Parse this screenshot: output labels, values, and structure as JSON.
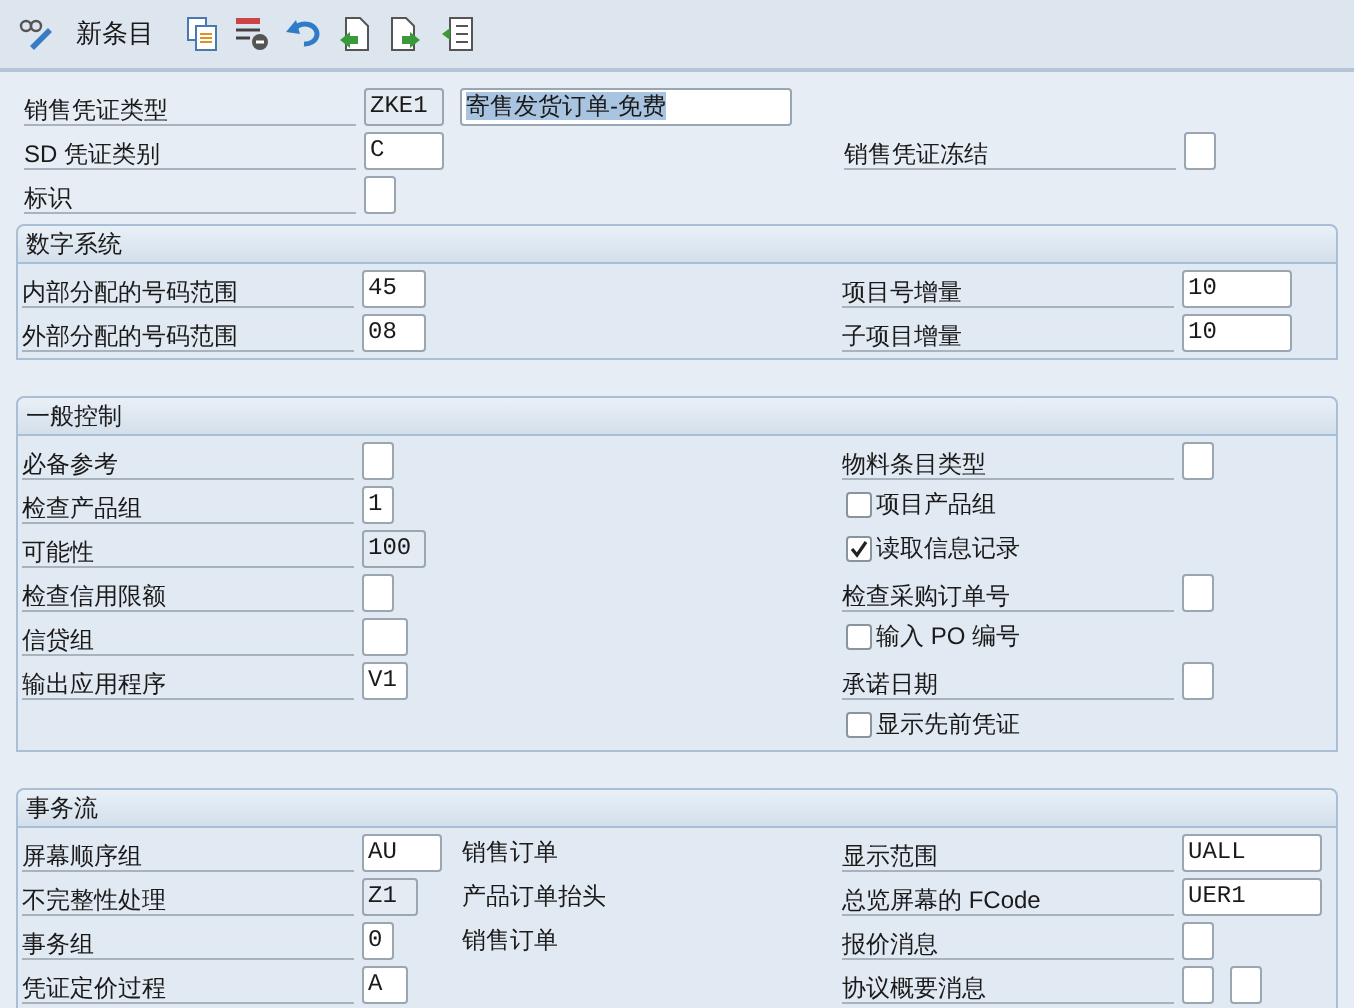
{
  "toolbar": {
    "label": "新条目"
  },
  "header": {
    "rows": [
      {
        "left": {
          "kind": "field",
          "label": "销售凭证类型",
          "value": "ZKE1",
          "readonly": true,
          "description": {
            "value": "寄售发货订单-免费",
            "highlighted": true
          }
        }
      },
      {
        "left": {
          "kind": "field",
          "label": "SD 凭证类别",
          "value": "C",
          "readonly": false
        },
        "right": {
          "kind": "field",
          "label": "销售凭证冻结",
          "readonly": false
        }
      },
      {
        "left": {
          "kind": "field",
          "label": "标识",
          "readonly": false
        }
      }
    ]
  },
  "sections": [
    {
      "title": "数字系统",
      "rows": [
        {
          "left": {
            "kind": "field",
            "label": "内部分配的号码范围",
            "value": "45",
            "readonly": false
          },
          "right": {
            "kind": "field",
            "label": "项目号增量",
            "value": "10",
            "readonly": false
          }
        },
        {
          "left": {
            "kind": "field",
            "label": "外部分配的号码范围",
            "value": "08",
            "readonly": false
          },
          "right": {
            "kind": "field",
            "label": "子项目增量",
            "value": "10",
            "readonly": false
          }
        }
      ]
    },
    {
      "title": "一般控制",
      "rows": [
        {
          "left": {
            "kind": "field",
            "label": "必备参考",
            "readonly": false
          },
          "right": {
            "kind": "field",
            "label": "物料条目类型",
            "readonly": false
          }
        },
        {
          "left": {
            "kind": "field",
            "label": "检查产品组",
            "value": "1",
            "readonly": false
          },
          "right": {
            "kind": "checkbox",
            "label": "项目产品组",
            "checked": false
          }
        },
        {
          "left": {
            "kind": "field",
            "label": "可能性",
            "value": "100",
            "readonly": true
          },
          "right": {
            "kind": "checkbox",
            "label": "读取信息记录",
            "checked": true
          }
        },
        {
          "left": {
            "kind": "field",
            "label": "检查信用限额",
            "readonly": false
          },
          "right": {
            "kind": "field",
            "label": "检查采购订单号",
            "readonly": false
          }
        },
        {
          "left": {
            "kind": "field",
            "label": "信贷组",
            "readonly": false
          },
          "right": {
            "kind": "checkbox",
            "label": "输入 PO 编号",
            "checked": false
          }
        },
        {
          "left": {
            "kind": "field",
            "label": "输出应用程序",
            "value": "V1",
            "readonly": false
          },
          "right": {
            "kind": "field",
            "label": "承诺日期",
            "readonly": false
          }
        },
        {
          "right": {
            "kind": "checkbox",
            "label": "显示先前凭证",
            "checked": false
          }
        }
      ]
    },
    {
      "title": "事务流",
      "rows": [
        {
          "left": {
            "kind": "field",
            "label": "屏幕顺序组",
            "value": "AU",
            "readonly": false,
            "note": "销售订单"
          },
          "right": {
            "kind": "field",
            "label": "显示范围",
            "value": "UALL",
            "readonly": false
          }
        },
        {
          "left": {
            "kind": "field",
            "label": "不完整性处理",
            "value": "Z1",
            "readonly": true,
            "note": "产品订单抬头"
          },
          "right": {
            "kind": "field",
            "label": "总览屏幕的 FCode",
            "value": "UER1",
            "readonly": false
          }
        },
        {
          "left": {
            "kind": "field",
            "label": "事务组",
            "value": "0",
            "readonly": false,
            "note": "销售订单"
          },
          "right": {
            "kind": "field",
            "label": "报价消息",
            "readonly": false
          }
        },
        {
          "left": {
            "kind": "field",
            "label": "凭证定价过程",
            "value": "A",
            "readonly": false
          },
          "right": {
            "kind": "field",
            "label": "协议概要消息",
            "readonly": false,
            "second_box": true
          }
        }
      ]
    }
  ]
}
